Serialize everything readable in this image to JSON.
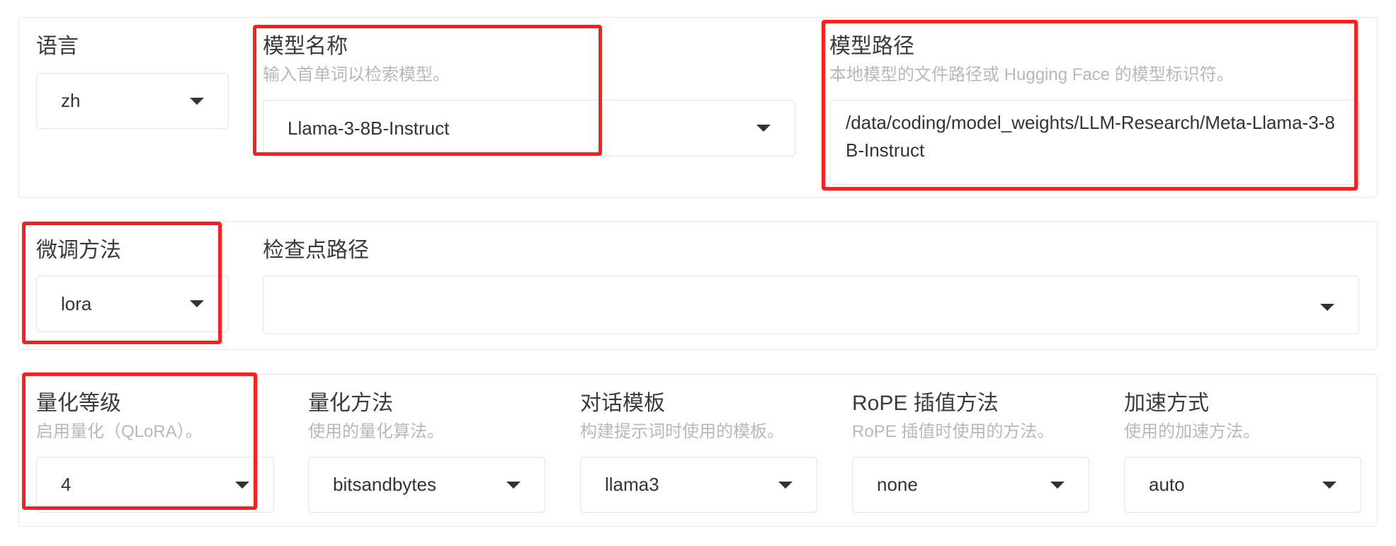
{
  "colors": {
    "highlight": "#ff1e1e",
    "label": "#3a3a3a",
    "info": "#b8b8b8",
    "border": "#e3e3e3"
  },
  "row1": {
    "lang": {
      "label": "语言",
      "value": "zh"
    },
    "model_name": {
      "label": "模型名称",
      "info": "输入首单词以检索模型。",
      "value": "Llama-3-8B-Instruct"
    },
    "model_path": {
      "label": "模型路径",
      "info": "本地模型的文件路径或 Hugging Face 的模型标识符。",
      "value": "/data/coding/model_weights/LLM-Research/Meta-Llama-3-8B-Instruct"
    }
  },
  "row2": {
    "finetune": {
      "label": "微调方法",
      "value": "lora"
    },
    "checkpoint": {
      "label": "检查点路径",
      "value": ""
    }
  },
  "row3": {
    "quant_bit": {
      "label": "量化等级",
      "info": "启用量化（QLoRA）。",
      "value": "4"
    },
    "quant_method": {
      "label": "量化方法",
      "info": "使用的量化算法。",
      "value": "bitsandbytes"
    },
    "template": {
      "label": "对话模板",
      "info": "构建提示词时使用的模板。",
      "value": "llama3"
    },
    "rope": {
      "label": "RoPE 插值方法",
      "info": "RoPE 插值时使用的方法。",
      "value": "none"
    },
    "booster": {
      "label": "加速方式",
      "info": "使用的加速方法。",
      "value": "auto"
    }
  }
}
